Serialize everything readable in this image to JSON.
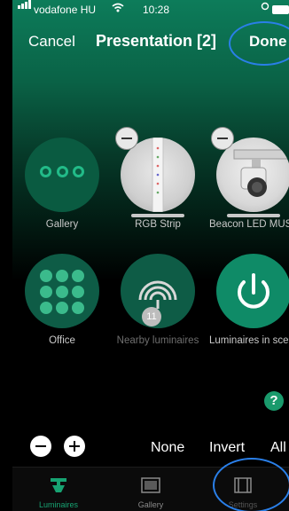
{
  "status_bar": {
    "carrier": "vodafone HU",
    "time": "10:28"
  },
  "nav": {
    "cancel_label": "Cancel",
    "title": "Presentation [2]",
    "done_label": "Done"
  },
  "tiles": [
    {
      "label": "Gallery"
    },
    {
      "label": "RGB Strip"
    },
    {
      "label": "Beacon LED MUSE"
    },
    {
      "label": "Office"
    },
    {
      "label": "Nearby luminaires",
      "badge": "11"
    },
    {
      "label": "Luminaires in scene"
    }
  ],
  "help_label": "?",
  "selection": {
    "none_label": "None",
    "invert_label": "Invert",
    "all_label": "All"
  },
  "tabs": [
    {
      "label": "Luminaires",
      "icon": "luminaire-icon"
    },
    {
      "label": "Gallery",
      "icon": "gallery-icon"
    },
    {
      "label": "Settings",
      "icon": "film-strip-icon"
    }
  ],
  "colors": {
    "accent": "#17a372",
    "annotation": "#2a7fe8"
  }
}
